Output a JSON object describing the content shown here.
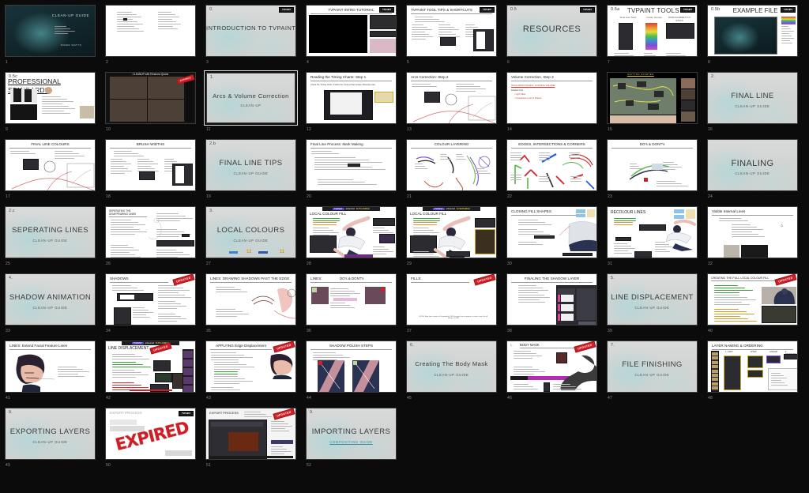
{
  "app": {
    "view": "slide-sorter",
    "deck_title": "CLEAN-UP GUIDE",
    "total_slides": 52,
    "columns": 8,
    "rows": 7,
    "background_color": "#0b0b0b",
    "selection_border_color": "#d8d8d8",
    "accent_stamp_color": "#cf2027",
    "link_color": "#2f93a8",
    "slide_number_color": "#8d8d8d"
  },
  "stamps": {
    "updated": "UPDATED",
    "expired": "EXPIRED",
    "tvpaint_badge": "TVPAINT",
    "tv_advanced": "advanced",
    "tv_edition": "11 Pro Edition",
    "tv_std_edition": "11 Std Edition"
  },
  "slides": [
    {
      "n": 1,
      "kind": "cover",
      "title": "CLEAN-UP GUIDE",
      "sub": "",
      "author": "MIRED WATTS",
      "selected": false
    },
    {
      "n": 2,
      "kind": "contents",
      "title": "",
      "sub": "",
      "selected": false
    },
    {
      "n": 3,
      "kind": "section",
      "num": "0.",
      "title": "INTRODUCTION TO TVPAINT",
      "sub": "",
      "selected": false,
      "badge": true
    },
    {
      "n": 4,
      "kind": "video",
      "title": "TVPAINT INTRO TUTORIAL",
      "sub": "",
      "selected": false,
      "badge": true
    },
    {
      "n": 5,
      "kind": "content-3col",
      "title": "TVPAINT TOOL TIPS & SHORTCUTS",
      "sub": "",
      "selected": false,
      "badge": true
    },
    {
      "n": 6,
      "kind": "section",
      "num": "0.5",
      "title": "RESOURCES",
      "sub": "",
      "selected": false,
      "badge": true
    },
    {
      "n": 7,
      "kind": "tools",
      "num": "0.5a",
      "title": "TVPAINT TOOLS",
      "sub": "",
      "cols": [
        "Final Line Tools",
        "Colour Groups",
        "DISPLACEMENT FX STACK"
      ],
      "selected": false,
      "badge": true
    },
    {
      "n": 8,
      "kind": "example",
      "num": "0.5b",
      "title": "EXAMPLE FILE",
      "sub": "",
      "selected": false,
      "badge": true
    },
    {
      "n": 9,
      "kind": "standards",
      "num": "0.5c",
      "title": "PROFESSIONAL STANDARDS",
      "sub": "",
      "selected": false
    },
    {
      "n": 10,
      "kind": "meeting",
      "title": "CLEANUP with Eleanora Quario",
      "sub": "",
      "selected": false,
      "badge": true
    },
    {
      "n": 11,
      "kind": "section",
      "num": "1.",
      "title": "Arcs & Volume Correction",
      "sub": "CLEAN-UP",
      "selected": true
    },
    {
      "n": 12,
      "kind": "content-vid",
      "title": "Reading the Timing Charts: Step 1",
      "sub": "",
      "note": "Check the Timing Chart / Follow the Timing Chart unless otherwise told",
      "selected": false
    },
    {
      "n": 13,
      "kind": "content-draw",
      "title": "Arcs Correction: Step 2",
      "sub": "",
      "selected": false
    },
    {
      "n": 14,
      "kind": "content-list",
      "title": "Volume Correction, Step 3",
      "sub": "",
      "red": "OCCLUSION ISSUES / LOOSING VOLUME",
      "items": [
        "Light Table",
        "Comparison Lines & Shapes"
      ],
      "selected": false
    },
    {
      "n": 15,
      "kind": "screenshare",
      "title": "GETTING STARTED",
      "sub": "",
      "selected": false
    },
    {
      "n": 16,
      "kind": "section",
      "num": "2.",
      "title": "FINAL LINE",
      "sub": "CLEAN-UP GUIDE",
      "selected": false
    },
    {
      "n": 17,
      "kind": "content-draw",
      "title": "FINAL LINE COLOURS",
      "sub": "",
      "centered": true,
      "selected": false
    },
    {
      "n": 18,
      "kind": "content-3col",
      "title": "BRUSH WIDTHS",
      "sub": "",
      "centered": true,
      "selected": false
    },
    {
      "n": 19,
      "kind": "section",
      "num": "2.b",
      "title": "FINAL LINE TIPS",
      "sub": "CLEAN-UP GUIDE",
      "selected": false
    },
    {
      "n": 20,
      "kind": "content-list",
      "title": "Final Line Process: Mark Making",
      "sub": "",
      "selected": false
    },
    {
      "n": 21,
      "kind": "content-draw",
      "title": "COLOUR LAYERING",
      "sub": "",
      "centered": true,
      "selected": false
    },
    {
      "n": 22,
      "kind": "content-arrows",
      "title": "EDGES, INTERSECTIONS & CORNERS",
      "sub": "",
      "centered": true,
      "selected": false
    },
    {
      "n": 23,
      "kind": "content-draw",
      "title": "DO's & DONT's",
      "sub": "",
      "centered": true,
      "selected": false
    },
    {
      "n": 24,
      "kind": "section",
      "num": "",
      "title": "FINALING",
      "sub": "CLEAN-UP GUIDE",
      "selected": false
    },
    {
      "n": 25,
      "kind": "section",
      "num": "2.c",
      "title": "SEPERATING LINES",
      "sub": "CLEAN-UP GUIDE",
      "selected": false
    },
    {
      "n": 26,
      "kind": "content-2col",
      "title": "SEPERATING THE DISAPPEARING LINES",
      "sub": "",
      "selected": false
    },
    {
      "n": 27,
      "kind": "section",
      "num": "3.",
      "title": "LOCAL COLOURS",
      "sub": "CLEAN-UP GUIDE",
      "logos": true,
      "selected": false
    },
    {
      "n": 28,
      "kind": "local-fill",
      "title": "LOCAL COLOUR FILL",
      "sub": "",
      "tvbar": true,
      "selected": false
    },
    {
      "n": 29,
      "kind": "local-fill2",
      "title": "LOCAL COLOUR FILL",
      "sub": "",
      "tvbar": true,
      "selected": false
    },
    {
      "n": 30,
      "kind": "closing",
      "title": "CLOSING FILL SHAPES",
      "sub": "",
      "selected": false
    },
    {
      "n": 31,
      "kind": "recolour",
      "title": "RECOLOUR LINES",
      "sub": "",
      "selected": false
    },
    {
      "n": 32,
      "kind": "content-list",
      "title": "Visible Internal Lines",
      "sub": "",
      "selected": false
    },
    {
      "n": 33,
      "kind": "section",
      "num": "4.",
      "title": "SHADOW ANIMATION",
      "sub": "CLEAN-UP GUIDE",
      "selected": false
    },
    {
      "n": 34,
      "kind": "shadows",
      "title": "SHADOWS",
      "sub": "",
      "stamp": "UPDATED",
      "selected": false
    },
    {
      "n": 35,
      "kind": "content-draw2",
      "title": "LINES: DRAWING SHADOWS PAST THE EDGE",
      "sub": "",
      "selected": false
    },
    {
      "n": 36,
      "kind": "dos-donts",
      "title": "LINES:",
      "sub": "DO's & DONT's",
      "selected": false
    },
    {
      "n": 37,
      "kind": "fills",
      "title": "FILLS:",
      "sub": "",
      "stamp": "UPDATED",
      "footer": "NOTE: Blue lines shown in Dreamdeck 2021 for more hours appear in colour used, for all filling in TVPA",
      "selected": false
    },
    {
      "n": 38,
      "kind": "finaling-sh",
      "title": "FINALING THE SHADOW LAYER",
      "sub": "",
      "centered": true,
      "selected": false
    },
    {
      "n": 39,
      "kind": "section",
      "num": "5.",
      "title": "LINE DISPLACEMENT",
      "sub": "CLEAN-UP GUIDE",
      "selected": false
    },
    {
      "n": 40,
      "kind": "creating-fill",
      "title": "CREATING THE FULL LOCAL COLOUR FILL",
      "sub": "",
      "stamp": "UPDATED",
      "selected": false
    },
    {
      "n": 41,
      "kind": "facial",
      "title": "LINES: Extend Facial Feature Lines",
      "sub": "",
      "selected": false
    },
    {
      "n": 42,
      "kind": "line-disp",
      "title": "LINE DISPLACEMENT",
      "sub": "",
      "stamp": "UPDATED",
      "tvbar": true,
      "selected": false
    },
    {
      "n": 43,
      "kind": "applying-ed",
      "title": "APPLYING Edge Displacement",
      "sub": "",
      "stamp": "UPDATED",
      "centered": true,
      "selected": false
    },
    {
      "n": 44,
      "kind": "polish",
      "title": "SHADOW POLISH STEPS",
      "sub": "",
      "centered": true,
      "selected": false
    },
    {
      "n": 45,
      "kind": "section",
      "num": "6.",
      "title": "Creating The Body Mask",
      "sub": "CLEAN-UP GUIDE",
      "selected": false
    },
    {
      "n": 46,
      "kind": "body-mask",
      "title": "BODY MASK",
      "num": "1.",
      "sub": "",
      "stamp": "UPDATED",
      "selected": false
    },
    {
      "n": 47,
      "kind": "section",
      "num": "7.",
      "title": "FILE FINISHING",
      "sub": "CLEAN-UP GUIDE",
      "selected": false
    },
    {
      "n": 48,
      "kind": "layer-naming",
      "title": "LAYER NAMING & ORDERING",
      "sub": "",
      "cols": [
        "1. LIGHT",
        "SHOW",
        "LINE ART",
        "4.  REFERENCE"
      ],
      "selected": false
    },
    {
      "n": 49,
      "kind": "section",
      "num": "8.",
      "title": "EXPORTING LAYERS",
      "sub": "CLEAN-UP GUIDE",
      "selected": false
    },
    {
      "n": 50,
      "kind": "expired",
      "title": "EXPORT PROCESS",
      "sub": "",
      "stamp": "EXPIRED",
      "selected": false
    },
    {
      "n": 51,
      "kind": "export",
      "title": "EXPORT PROCESS",
      "sub": "",
      "stamp": "UPDATED",
      "selected": false
    },
    {
      "n": 52,
      "kind": "section",
      "num": "9.",
      "title": "IMPORTING LAYERS",
      "sub": "COMPOSITING GUIDE",
      "sub_is_link": true,
      "selected": false
    }
  ]
}
